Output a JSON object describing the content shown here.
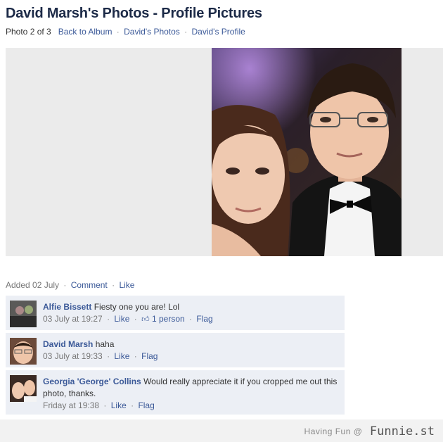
{
  "page": {
    "title": "David Marsh's Photos - Profile Pictures"
  },
  "subnav": {
    "counter": "Photo 2 of 3",
    "back_to_album": "Back to Album",
    "davids_photos": "David's Photos",
    "davids_profile": "David's Profile",
    "separator": "·"
  },
  "meta": {
    "added": "Added 02 July",
    "comment_link": "Comment",
    "like_link": "Like"
  },
  "comments": [
    {
      "author": "Alfie Bissett",
      "text": " Fiesty one you are! Lol",
      "time": "03 July at 19:27",
      "like": "Like",
      "likes_count": "1 person",
      "flag": "Flag"
    },
    {
      "author": "David Marsh",
      "text": " haha",
      "time": "03 July at 19:33",
      "like": "Like",
      "flag": "Flag"
    },
    {
      "author": "Georgia 'George' Collins",
      "text": " Would really appreciate it if you cropped me out this photo, thanks.",
      "time": "Friday at 19:38",
      "like": "Like",
      "flag": "Flag"
    }
  ],
  "watermark": {
    "prefix": "Having Fun @",
    "brand": "Funnie.st"
  },
  "colors": {
    "link": "#3b5998",
    "title": "#1c2a47",
    "comment_bg": "#eceff5",
    "photo_stage": "#ebebeb"
  }
}
